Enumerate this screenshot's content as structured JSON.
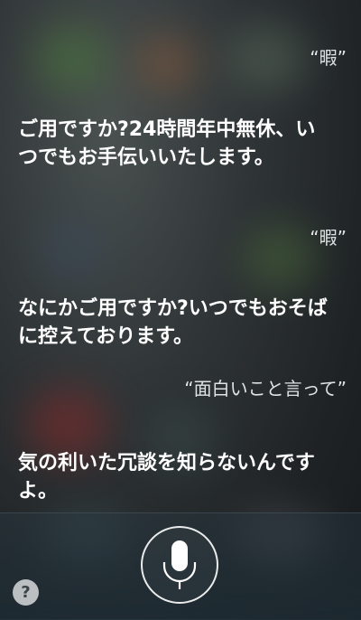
{
  "conversation": {
    "user_1": "“暇”",
    "siri_1": "ご用ですか?24時間年中無休、いつでもお手伝いいたします。",
    "user_2": "“暇”",
    "siri_2": "なにかご用ですか?いつでもおそばに控えております。",
    "user_3": "“面白いこと言って”",
    "siri_3": "気の利いた冗談を知らないんですよ。"
  },
  "controls": {
    "help_label": "?",
    "mic_icon": "microphone-icon",
    "help_icon": "question-mark-icon"
  }
}
